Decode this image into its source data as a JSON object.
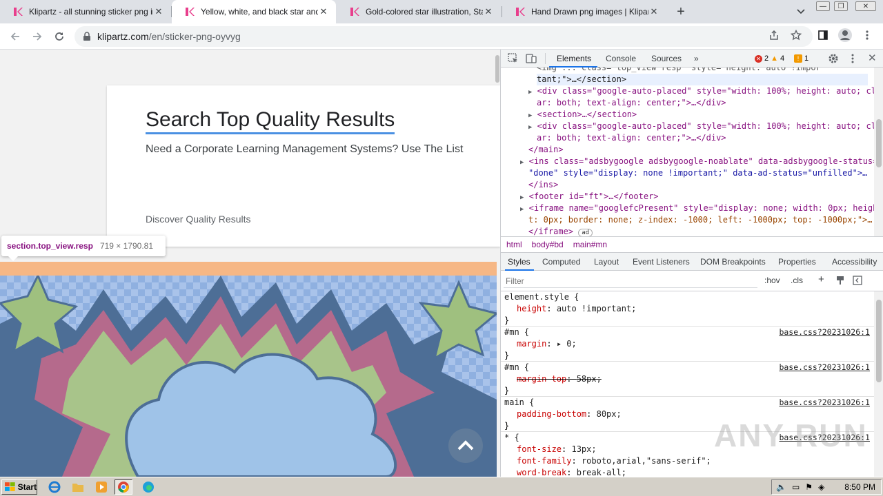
{
  "browser": {
    "tabs": [
      {
        "title": "Klipartz - all stunning sticker png ima",
        "active": false
      },
      {
        "title": "Yellow, white, and black star and clo",
        "active": true
      },
      {
        "title": "Gold-colored star illustration, Star De",
        "active": false
      },
      {
        "title": "Hand Drawn png images | Klipartz",
        "active": false
      }
    ],
    "address": {
      "domain": "klipartz.com",
      "path": "/en/sticker-png-oyvyg"
    }
  },
  "page": {
    "heading": "Search Top Quality Results",
    "subheading": "Need a Corporate Learning Management Systems? Use The List",
    "discover": "Discover Quality Results",
    "tooltip": {
      "selector": "section.top_view.resp",
      "dims": "719 × 1790.81"
    }
  },
  "devtools": {
    "tabs": [
      "Elements",
      "Console",
      "Sources",
      "»"
    ],
    "errors": "2",
    "warnings": "4",
    "issues": "1",
    "dom": {
      "l1": "<img ... class=\"top_view resp\" style=\"height: auto !impor",
      "l2": "tant;\">…</section>",
      "l3a": "<div class=\"google-auto-placed\" style=\"width: 100%; height: auto; cle",
      "l3b": "ar: both; text-align: center;\">…</div>",
      "l4": "<section>…</section>",
      "l5a": "<div class=\"google-auto-placed\" style=\"width: 100%; height: auto; cle",
      "l5b": "ar: both; text-align: center;\">…</div>",
      "l6": "</main>",
      "l7a": "<ins class=\"adsbygoogle adsbygoogle-noablate\" data-adsbygoogle-status=",
      "l7b": "\"done\" style=\"display: none !important;\" data-ad-status=\"unfilled\">…",
      "l7c": "</ins>",
      "l8": "<footer id=\"ft\">…</footer>",
      "l9a": "<iframe name=\"googlefcPresent\" style=\"display: none; width: 0px; heigh",
      "l9b": "t: 0px; border: none; z-index: -1000; left: -1000px; top: -1000px;\">…",
      "l9c": "</iframe>",
      "ad": "ad"
    },
    "breadcrumbs": [
      "html",
      "body#bd",
      "main#mn"
    ],
    "subtabs": [
      "Styles",
      "Computed",
      "Layout",
      "Event Listeners",
      "DOM Breakpoints",
      "Properties",
      "Accessibility"
    ],
    "filter_placeholder": "Filter",
    "hov": ":hov",
    "cls": ".cls",
    "rules": [
      {
        "selector": "element.style {",
        "src": "",
        "props": [
          {
            "name": "height",
            "value": "auto !important;"
          }
        ]
      },
      {
        "selector": "#mn {",
        "src": "base.css?20231026:1",
        "props": [
          {
            "name": "margin",
            "value": "▸ 0;"
          }
        ]
      },
      {
        "selector": "#mn {",
        "src": "base.css?20231026:1",
        "props": [
          {
            "name": "margin-top",
            "value": "58px;"
          }
        ]
      },
      {
        "selector": "main {",
        "src": "base.css?20231026:1",
        "props": [
          {
            "name": "padding-bottom",
            "value": "80px;"
          }
        ]
      },
      {
        "selector": "* {",
        "src": "base.css?20231026:1",
        "props": [
          {
            "name": "font-size",
            "value": "13px;"
          },
          {
            "name": "font-family",
            "value": "roboto,arial,\"sans-serif\";"
          },
          {
            "name": "word-break",
            "value": "break-all;"
          }
        ]
      }
    ],
    "close_brace": "}"
  },
  "taskbar": {
    "start": "Start",
    "clock": "8:50 PM"
  },
  "watermark": "ANY RUN",
  "colors": {
    "accent": "#1a73e8",
    "tag": "#881280",
    "attr": "#994500",
    "attrval": "#1a1aa6",
    "prop": "#c80000"
  }
}
